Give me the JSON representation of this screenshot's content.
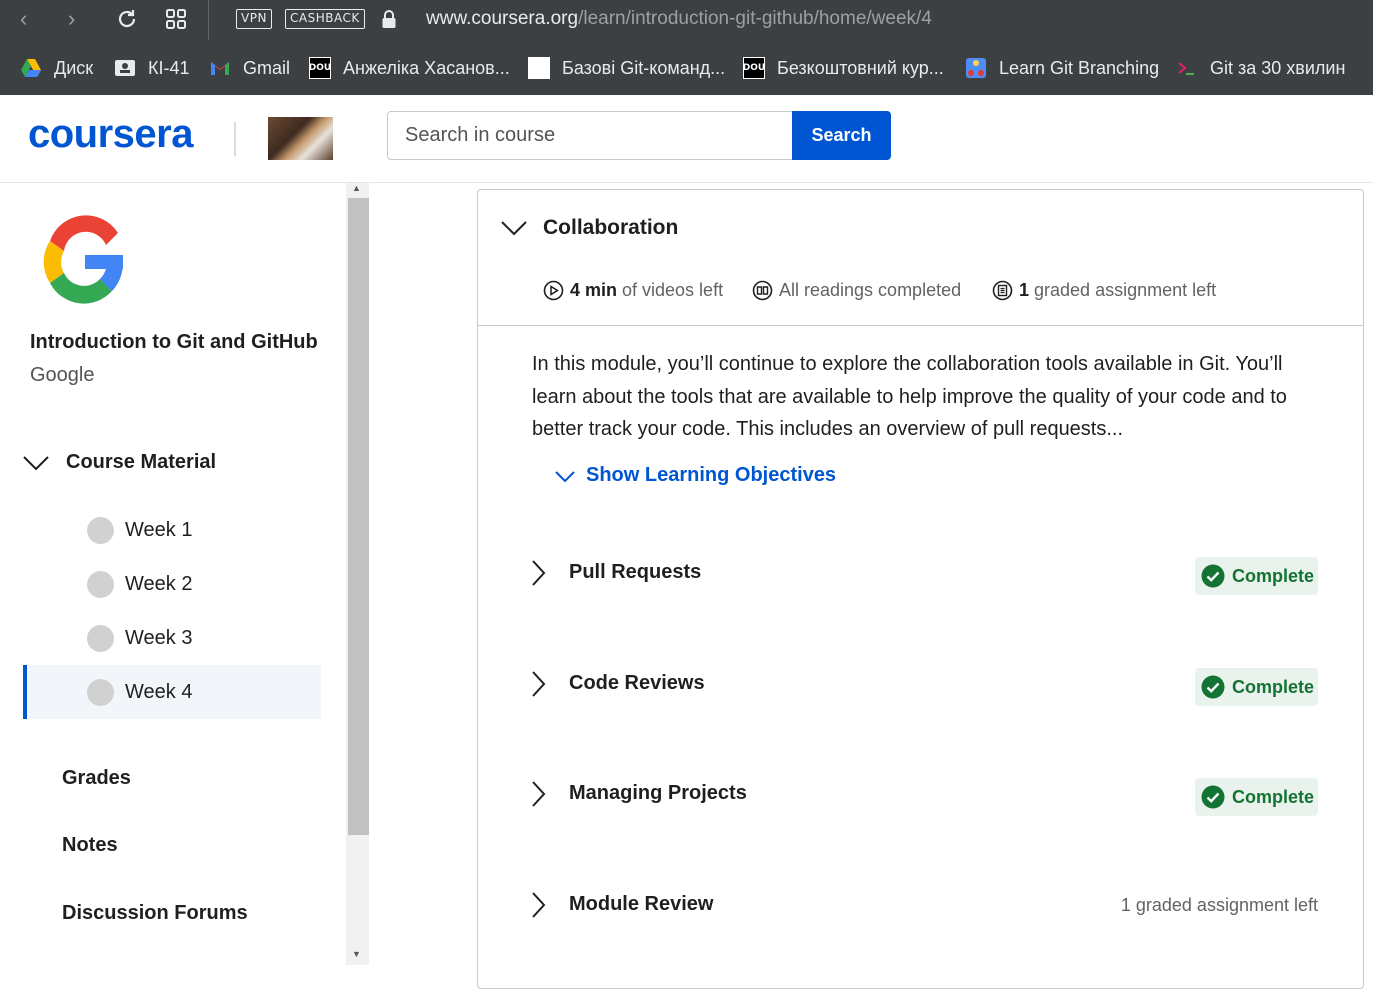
{
  "browser": {
    "url_host": "www.coursera.org",
    "url_path": "/learn/introduction-git-github/home/week/4",
    "vpn_label": "VPN",
    "cashback_label": "CASHBACK",
    "bookmarks": [
      {
        "label": "Диск",
        "icon": "google-drive-icon"
      },
      {
        "label": "КІ-41",
        "icon": "classroom-icon"
      },
      {
        "label": "Gmail",
        "icon": "gmail-icon"
      },
      {
        "label": "Анжеліка Хасанов...",
        "icon": "dou-icon",
        "icon_text": "DOU"
      },
      {
        "label": "Базові Git-команд...",
        "icon": "page-icon"
      },
      {
        "label": "Безкоштовний кур...",
        "icon": "dou-icon",
        "icon_text": "DOU"
      },
      {
        "label": "Learn Git Branching",
        "icon": "git-branching-icon"
      },
      {
        "label": "Git за 30 хвилин",
        "icon": "terminal-icon"
      }
    ]
  },
  "header": {
    "logo": "coursera",
    "search_placeholder": "Search in course",
    "search_button": "Search"
  },
  "sidebar": {
    "course_title": "Introduction to Git and GitHub",
    "course_org": "Google",
    "section_label": "Course Material",
    "weeks": [
      "Week 1",
      "Week 2",
      "Week 3",
      "Week 4"
    ],
    "active_week": "Week 4",
    "links": [
      "Grades",
      "Notes",
      "Discussion Forums"
    ]
  },
  "module": {
    "title": "Collaboration",
    "videos_bold": "4 min",
    "videos_rest": "of videos left",
    "readings": "All readings completed",
    "graded_bold": "1",
    "graded_rest": "graded assignment left",
    "description": "In this module, you’ll continue to explore the collaboration tools available in Git. You’ll learn about the tools that are available to help improve the quality of your code and to better track your code. This includes an overview of pull requests...",
    "show_objectives": "Show Learning Objectives",
    "lessons": [
      {
        "title": "Pull Requests",
        "status": "Complete"
      },
      {
        "title": "Code Reviews",
        "status": "Complete"
      },
      {
        "title": "Managing Projects",
        "status": "Complete"
      },
      {
        "title": "Module Review",
        "status": "1 graded assignment left"
      }
    ]
  },
  "colors": {
    "brand": "#0056d2",
    "complete_green": "#137333",
    "complete_bg": "#eaf2ee"
  }
}
